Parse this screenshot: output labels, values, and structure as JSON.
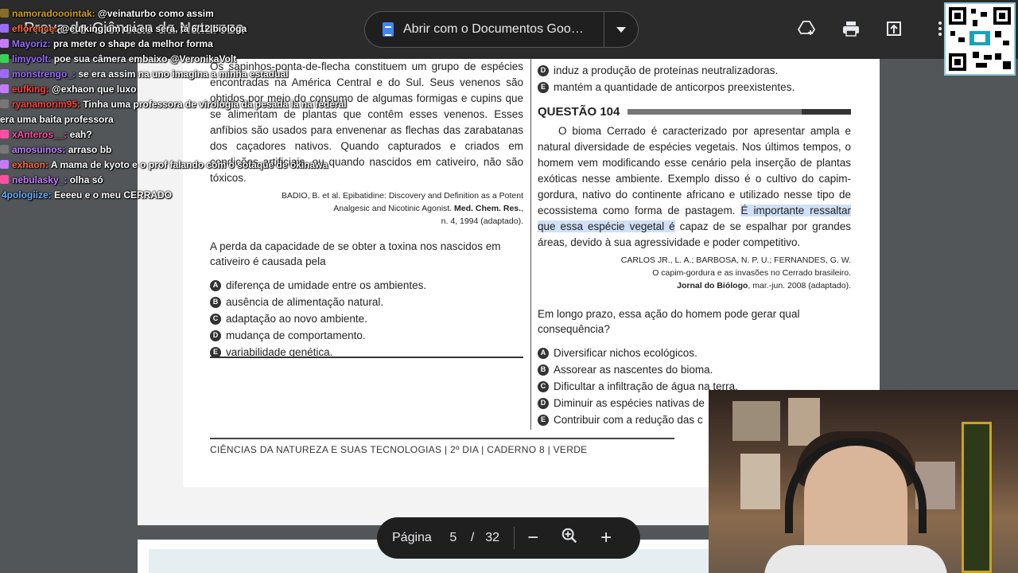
{
  "toolbar": {
    "title": "Prova de Ciências da Natureza",
    "open_with": "Abrir com o Documentos Goo…",
    "icons": [
      "add-to-drive-icon",
      "print-icon",
      "open-in-new-icon",
      "more-vert-icon"
    ]
  },
  "pdf": {
    "left_col": {
      "passage": "Os sapinhos-ponta-de-flecha constituem um grupo de espécies encontradas na América Central e do Sul. Seus venenos são obtidos por meio do consumo de algumas formigas e cupins que se alimentam de plantas que contêm esses venenos. Esses anfíbios são usados para envenenar as flechas das zarabatanas dos caçadores nativos. Quando capturados e criados em condições artificiais, ou quando nascidos em cativeiro, não são tóxicos.",
      "cite_line1": "BADIO, B. et al. Epibatidine: Discovery and Definition as a Potent",
      "cite_line2_pre": "Analgesic and Nicotinic Agonist. ",
      "cite_line2_bold": "Med. Chem. Res.",
      "cite_line2_post": ",",
      "cite_line3": "n. 4, 1994 (adaptado).",
      "question": "A perda da capacidade de se obter a toxina nos nascidos em cativeiro é causada pela",
      "options": [
        {
          "letter": "A",
          "text": "diferença de umidade entre os ambientes."
        },
        {
          "letter": "B",
          "text": "ausência de alimentação natural."
        },
        {
          "letter": "C",
          "text": "adaptação ao novo ambiente."
        },
        {
          "letter": "D",
          "text": "mudança de comportamento."
        },
        {
          "letter": "E",
          "text": "variabilidade genética."
        }
      ]
    },
    "right_col": {
      "prev_options": [
        {
          "letter": "D",
          "text": "induz a produção de proteínas neutralizadoras."
        },
        {
          "letter": "E",
          "text": "mantém a quantidade de anticorpos preexistentes."
        }
      ],
      "question_title": "QUESTÃO 104",
      "passage_pre": "O bioma Cerrado é caracterizado por apresentar ampla e natural diversidade de espécies vegetais. Nos últimos tempos, o homem vem modificando esse cenário pela inserção de plantas exóticas nesse ambiente. Exemplo disso é o cultivo do capim-gordura, nativo do continente africano e utilizado nesse tipo de ecossistema como forma de pastagem. ",
      "passage_hl": "É importante ressaltar que essa espécie vegetal é",
      "passage_post": " capaz de se espalhar por grandes áreas, devido à sua agressividade e poder competitivo.",
      "cite_line1": "CARLOS JR., L. A.; BARBOSA, N. P. U.; FERNANDES, G. W.",
      "cite_line2": "O capim-gordura e as invasões no Cerrado brasileiro.",
      "cite_line3_bold": "Jornal do Biólogo",
      "cite_line3_post": ", mar.-jun. 2008 (adaptado).",
      "question": "Em longo prazo, essa ação do homem pode gerar qual consequência?",
      "options": [
        {
          "letter": "A",
          "text": "Diversificar nichos ecológicos."
        },
        {
          "letter": "B",
          "text": "Assorear as nascentes do bioma."
        },
        {
          "letter": "C",
          "text": "Dificultar a infiltração de água na terra."
        },
        {
          "letter": "D",
          "text": "Diminuir as espécies nativas de"
        },
        {
          "letter": "E",
          "text": "Contribuir com a redução das c"
        }
      ]
    },
    "footer": "CIÊNCIAS DA NATUREZA E SUAS TECNOLOGIAS | 2º DIA | CADERNO 8 | VERDE"
  },
  "page_controls": {
    "label": "Página",
    "current": "5",
    "separator": "/",
    "total": "32",
    "zoom_out": "−",
    "zoom_in": "+"
  },
  "chat": [
    {
      "user": "namoradooointak:",
      "text": "@veinaturbo como assim",
      "color": "#d4a017"
    },
    {
      "user": "eflorence:",
      "text": "@eufking um dia ela será, tá 6/12 bióloga",
      "color": "#ff6a3d"
    },
    {
      "user": "Mayoriz:",
      "text": "pra meter o shape da melhor forma",
      "color": "#9b6bff"
    },
    {
      "user": "limyvolt:",
      "text": "poe sua câmera embaixo @VeronikaVolt",
      "color": "#9b6bff"
    },
    {
      "user": "monstrengo_:",
      "text": "se era assim na uno imagina a minha estadual",
      "color": "#9b6bff"
    },
    {
      "user": "eufking:",
      "text": "@exhaon que luxo",
      "color": "#ff4040"
    },
    {
      "user": "ryanamorim95:",
      "text": "Tinha uma professora de virologia da pesada la na federal",
      "color": "#ff4040"
    },
    {
      "user": "",
      "text": "era uma baita professora",
      "color": "#ffffff"
    },
    {
      "user": "xAnteros__:",
      "text": "eah?",
      "color": "#ff4fa3"
    },
    {
      "user": "amosuinos:",
      "text": "arraso bb",
      "color": "#c67bff"
    },
    {
      "user": "exhaon:",
      "text": "A mama de kyoto e o prof falando com o sotaque de okinawa",
      "color": "#ff6a3d"
    },
    {
      "user": "nebulasky_:",
      "text": "olha só",
      "color": "#c67bff"
    },
    {
      "user": "4pologiize:",
      "text": "Eeeeu e o meu CERRADO",
      "color": "#6ab0ff"
    }
  ]
}
